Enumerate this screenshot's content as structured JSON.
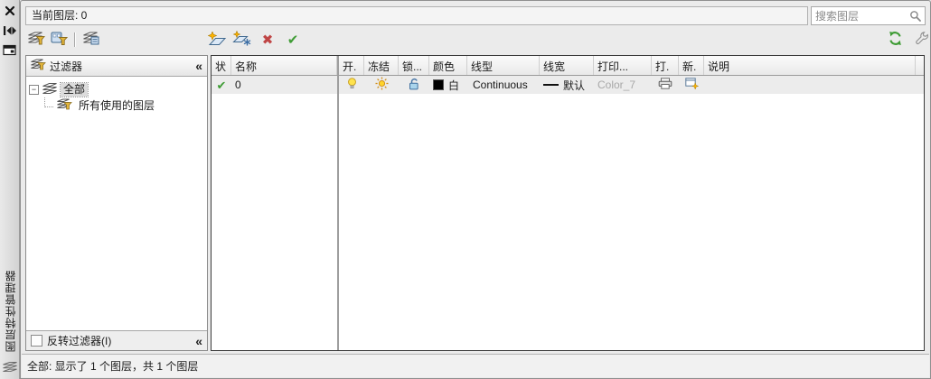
{
  "palette": {
    "vertical_title": "图层特性管理器",
    "current_layer": "当前图层: 0",
    "search_placeholder": "搜索图层"
  },
  "filters": {
    "header": "过滤器",
    "items": [
      {
        "label": "全部"
      },
      {
        "label": "所有使用的图层"
      }
    ],
    "invert_label": "反转过滤器(I)"
  },
  "layers": {
    "columns": [
      "状",
      "名称",
      "开.",
      "冻结",
      "锁...",
      "颜色",
      "线型",
      "线宽",
      "打印...",
      "打.",
      "新.",
      "说明"
    ],
    "rows": [
      {
        "name": "0",
        "color": "白",
        "linetype": "Continuous",
        "lineweight": "默认",
        "plot_style": "Color_7",
        "description": ""
      }
    ]
  },
  "status_bar": {
    "text": "全部: 显示了 1 个图层，共 1 个图层"
  },
  "glyphs": {
    "collapse": "«",
    "check": "✔",
    "delete": "✖",
    "expand_minus": "−"
  },
  "colors": {
    "current_check_green": "#3f9c35",
    "delete_red": "#bf4545",
    "bulb_yellow": "#ffe34d",
    "plot_style_muted": "#a8a8a8",
    "swatch_black": "#000000"
  }
}
